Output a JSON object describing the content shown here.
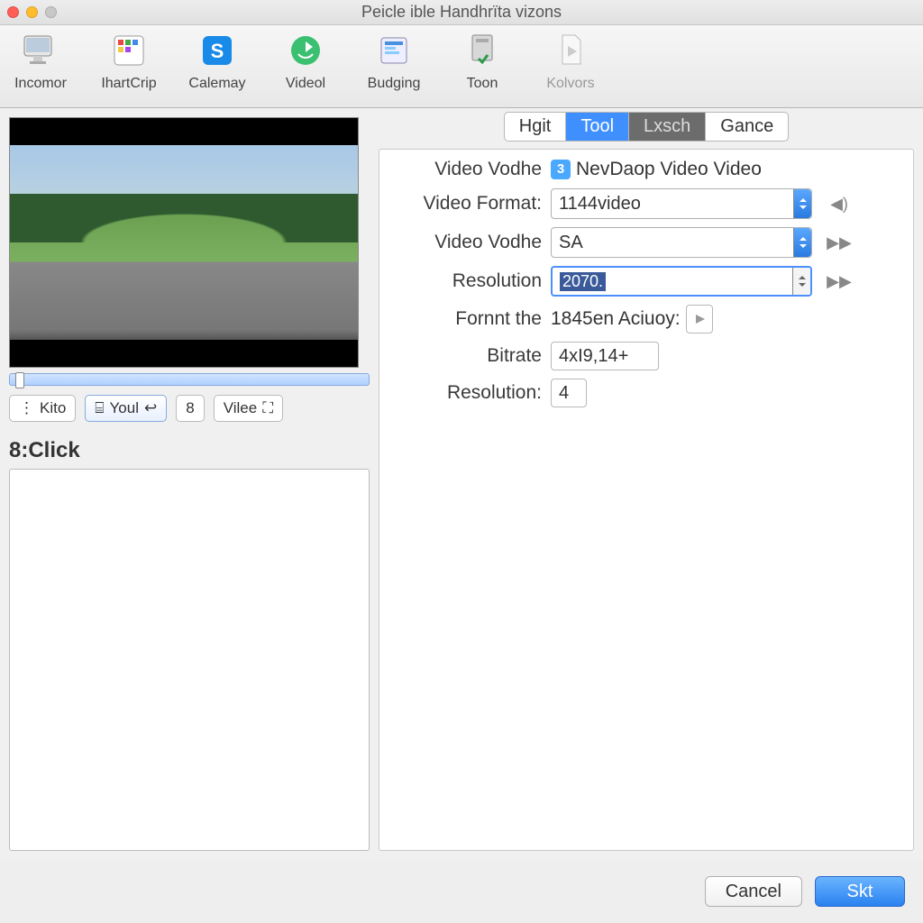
{
  "window": {
    "title": "Peicle ible Handhrïta vizons"
  },
  "toolbar": {
    "items": [
      {
        "label": "Incomor",
        "icon": "monitor"
      },
      {
        "label": "IhartCrip",
        "icon": "palette"
      },
      {
        "label": "Calemay",
        "icon": "skype"
      },
      {
        "label": "Videol",
        "icon": "sync"
      },
      {
        "label": "Budging",
        "icon": "taskmgr"
      },
      {
        "label": "Toon",
        "icon": "shield"
      },
      {
        "label": "Kolvors",
        "icon": "doc",
        "dim": true
      }
    ]
  },
  "tabs": {
    "items": [
      "Hgit",
      "Tool",
      "Lxsch",
      "Gance"
    ],
    "active_index": 1,
    "muted_index": 2
  },
  "preview": {
    "ctrl1": "Kito",
    "ctrl2": "Youl",
    "ctrl3": "8",
    "ctrl4": "Vilee"
  },
  "click_label": "8:Click",
  "form": {
    "rows": [
      {
        "label": "Video Vodhe",
        "badge": "3",
        "text": "NevDaop Video Video"
      },
      {
        "label": "Video Format:",
        "combo": "1144video",
        "stepper": "blue",
        "side": "sound"
      },
      {
        "label": "Video Vodhe",
        "combo": "SA",
        "stepper": "blue",
        "side": "play"
      },
      {
        "label": "Resolution",
        "combo_sel": "2070.",
        "stepper": "plain",
        "side": "play",
        "focused": true
      },
      {
        "label": "Fornnt the",
        "text": "1845en Aciuoy:",
        "smallicon": true
      },
      {
        "label": "Bitrate",
        "small": "4xI9,14+"
      },
      {
        "label": "Resolution:",
        "small": "4"
      }
    ]
  },
  "footer": {
    "cancel": "Cancel",
    "ok": "Skt"
  }
}
